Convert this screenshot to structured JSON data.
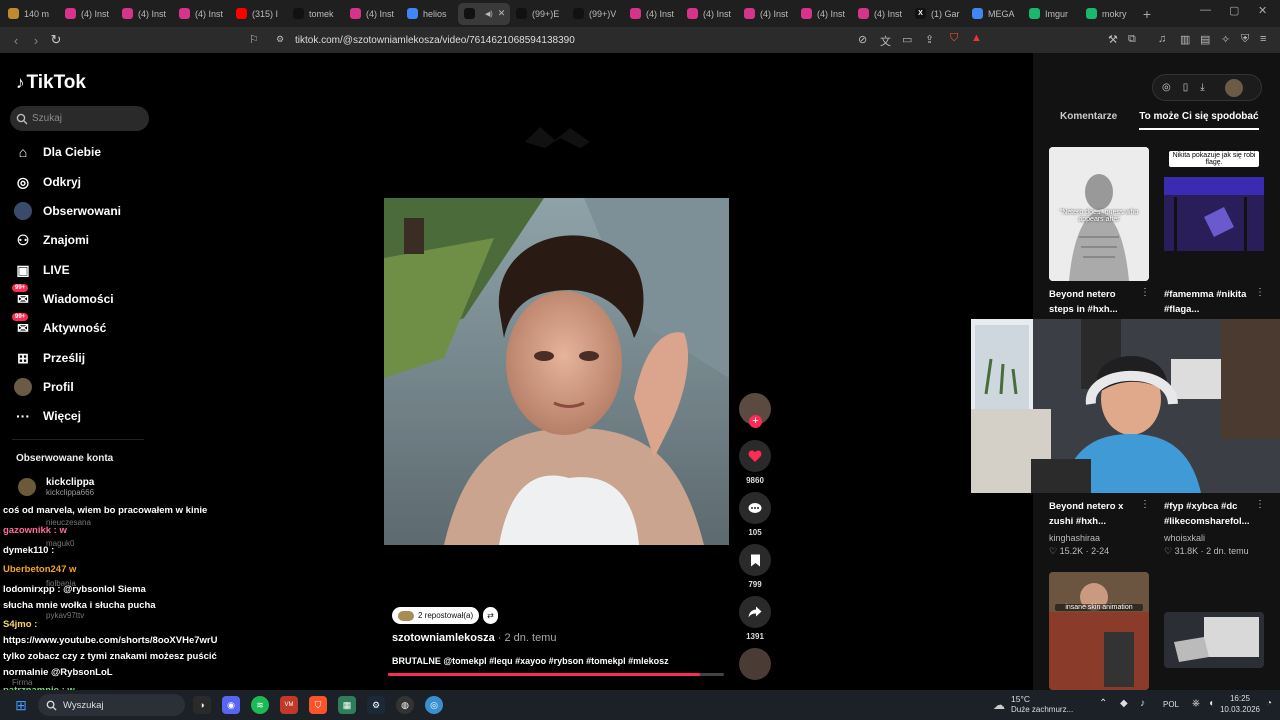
{
  "browser": {
    "tabs": [
      {
        "title": "140 m",
        "color": "#c08a2e",
        "glyph": ""
      },
      {
        "title": "(4) Inst",
        "color": "#d6338b",
        "glyph": ""
      },
      {
        "title": "(4) Inst",
        "color": "#d6338b",
        "glyph": ""
      },
      {
        "title": "(4) Inst",
        "color": "#d6338b",
        "glyph": ""
      },
      {
        "title": "(315) I",
        "color": "#ff0000",
        "glyph": ""
      },
      {
        "title": "tomek",
        "color": "#111111",
        "glyph": ""
      },
      {
        "title": "(4) Inst",
        "color": "#d6338b",
        "glyph": ""
      },
      {
        "title": "helios",
        "color": "#4285f4",
        "glyph": ""
      },
      {
        "title": "",
        "color": "#111111",
        "glyph": "",
        "active": true
      },
      {
        "title": "(99+)E",
        "color": "#111111",
        "glyph": ""
      },
      {
        "title": "(99+)V",
        "color": "#111111",
        "glyph": ""
      },
      {
        "title": "(4) Inst",
        "color": "#d6338b",
        "glyph": ""
      },
      {
        "title": "(4) Inst",
        "color": "#d6338b",
        "glyph": ""
      },
      {
        "title": "(4) Inst",
        "color": "#d6338b",
        "glyph": ""
      },
      {
        "title": "(4) Inst",
        "color": "#d6338b",
        "glyph": ""
      },
      {
        "title": "(4) Inst",
        "color": "#d6338b",
        "glyph": ""
      },
      {
        "title": "(1) Gar",
        "color": "#111111",
        "glyph": "X"
      },
      {
        "title": "MEGA",
        "color": "#4285f4",
        "glyph": ""
      },
      {
        "title": "Imgur",
        "color": "#1bb76e",
        "glyph": ""
      },
      {
        "title": "mokry",
        "color": "#1bb76e",
        "glyph": ""
      }
    ],
    "url": "tiktok.com/@szotowniamlekosza/video/7614621068594138390"
  },
  "sidebar": {
    "logo": "TikTok",
    "search_placeholder": "Szukaj",
    "items": [
      {
        "label": "Dla Ciebie",
        "icon": "⌂"
      },
      {
        "label": "Odkryj",
        "icon": "◎"
      },
      {
        "label": "Obserwowani",
        "icon": ""
      },
      {
        "label": "Znajomi",
        "icon": "⚇"
      },
      {
        "label": "LIVE",
        "icon": "▣"
      },
      {
        "label": "Wiadomości",
        "icon": "✉",
        "badge": "99+"
      },
      {
        "label": "Aktywność",
        "icon": "✉",
        "badge": "99+"
      },
      {
        "label": "Prześlij",
        "icon": "⊞"
      },
      {
        "label": "Profil",
        "icon": ""
      },
      {
        "label": "Więcej",
        "icon": "···"
      }
    ],
    "followed_title": "Obserwowane konta",
    "followed_accounts": [
      {
        "name": "kickclippa",
        "handle": "kickclippa666"
      },
      {
        "name": "",
        "handle": "nieuczesana"
      },
      {
        "name": "",
        "handle": "maguk0"
      },
      {
        "name": "",
        "handle": "fiolbania"
      },
      {
        "name": "",
        "handle": "pykav97ttv"
      },
      {
        "name": "Firma",
        "handle": ""
      }
    ]
  },
  "video": {
    "counts": {
      "likes": "9860",
      "comments": "105",
      "saves": "799",
      "shares": "1391"
    },
    "reposts": "2 repostował(a)",
    "author": "szotowniamlekosza",
    "time_ago": "· 2 dn. temu",
    "caption": "BRUTALNE @tomekpl #lequ #xayoo #rybson #tomekpl #mlekosz",
    "progress": 0.93
  },
  "right_panel": {
    "tabs": [
      "Komentarze",
      "To może Ci się spodobać"
    ],
    "cards": [
      {
        "title": "Beyond netero steps in #hxh...",
        "overlay": "\"Netero does\" guess who appears after",
        "user": "",
        "stats": ""
      },
      {
        "title": "#famemma #nikita #flaga...",
        "overlay": "Nikita pokazuje jak się robi flagę.",
        "user": "",
        "stats": ""
      },
      {
        "title": "Beyond netero x zushi #hxh...",
        "overlay": "",
        "user": "kinghashiraa",
        "stats": "♡ 15.2K · 2-24"
      },
      {
        "title": "#fyp #xybca #dc #likecomsharefol...",
        "overlay": "",
        "user": "whoisxkali",
        "stats": "♡ 31.8K · 2 dn. temu"
      },
      {
        "title": "",
        "overlay": "insane skin animation",
        "user": "",
        "stats": ""
      },
      {
        "title": "",
        "overlay": "",
        "user": "",
        "stats": ""
      }
    ]
  },
  "chat": [
    {
      "text": "coś od marvela, wiem bo pracowałem w kinie",
      "color": "#ffffff"
    },
    {
      "text": "gazownikk : w",
      "color": "#ff6b9a"
    },
    {
      "text": "dymek110 :",
      "color": "#ffffff"
    },
    {
      "text": "Uberbeton247 w",
      "color": "#f5a623"
    },
    {
      "text": "lodomirxpp : @rybsonlol Siema",
      "color": "#ffffff"
    },
    {
      "text": "słucha mnie wołka i słucha pucha",
      "color": "#ffffff"
    },
    {
      "text": "S4jmo :",
      "color": "#f5d76e"
    },
    {
      "text": "https://www.youtube.com/shorts/8ooXVHe7wrU",
      "color": "#ffffff"
    },
    {
      "text": "tylko zobacz czy z tymi znakami możesz puścić",
      "color": "#ffffff"
    },
    {
      "text": "normalnie @RybsonLoL",
      "color": "#ffffff"
    },
    {
      "text": "patrznamnie : w",
      "color": "#7bd97b"
    }
  ],
  "taskbar": {
    "search": "Wyszukaj",
    "weather_temp": "15°C",
    "weather_desc": "Duże zachmurz...",
    "lang": "POL",
    "time": "16:25",
    "date": "10.03.2026"
  }
}
